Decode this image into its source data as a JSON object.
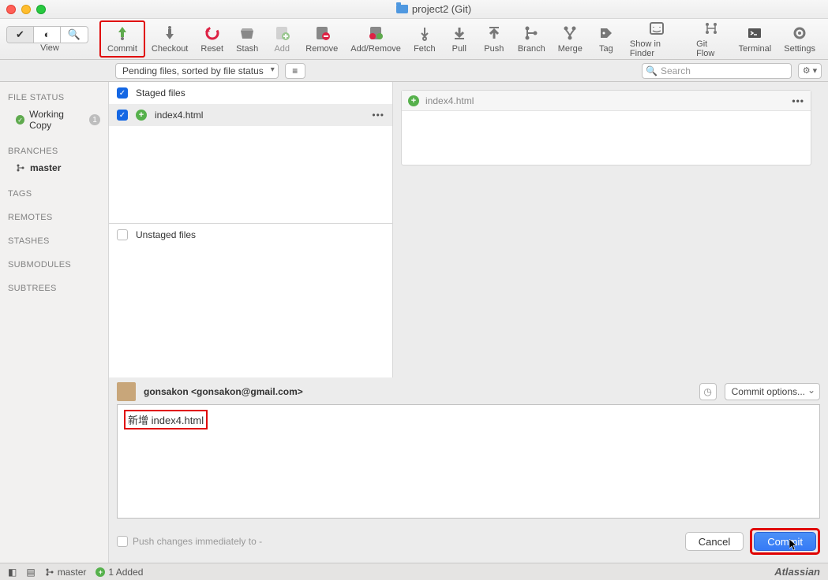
{
  "window": {
    "title": "project2 (Git)"
  },
  "toolbar": {
    "view": "View",
    "commit": "Commit",
    "checkout": "Checkout",
    "reset": "Reset",
    "stash": "Stash",
    "add": "Add",
    "remove": "Remove",
    "addremove": "Add/Remove",
    "fetch": "Fetch",
    "pull": "Pull",
    "push": "Push",
    "branch": "Branch",
    "merge": "Merge",
    "tag": "Tag",
    "finder": "Show in Finder",
    "gitflow": "Git Flow",
    "terminal": "Terminal",
    "settings": "Settings"
  },
  "filter": {
    "dropdown": "Pending files, sorted by file status",
    "search_placeholder": "Search"
  },
  "sidebar": {
    "file_status": "FILE STATUS",
    "working_copy": "Working Copy",
    "working_badge": "1",
    "branches": "BRANCHES",
    "master": "master",
    "tags": "TAGS",
    "remotes": "REMOTES",
    "stashes": "STASHES",
    "submodules": "SUBMODULES",
    "subtrees": "SUBTREES"
  },
  "staged": {
    "header": "Staged files",
    "file": "index4.html"
  },
  "unstaged": {
    "header": "Unstaged files"
  },
  "diff": {
    "file": "index4.html"
  },
  "commit_area": {
    "author": "gonsakon <gonsakon@gmail.com>",
    "options": "Commit options...",
    "message": "新增 index4.html",
    "push_label": "Push changes immediately to -",
    "cancel": "Cancel",
    "commit": "Commit"
  },
  "status": {
    "branch": "master",
    "added": "1 Added",
    "brand": "Atlassian"
  }
}
